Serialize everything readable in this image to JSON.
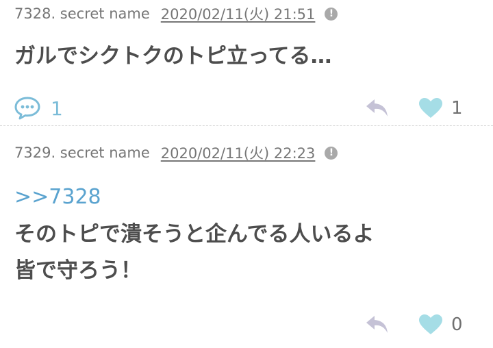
{
  "comments": [
    {
      "number_name": "7328. secret name",
      "datetime": "2020/02/11(火) 21:51",
      "body_lines": [
        "ガルでシクトクのトピ立ってる…"
      ],
      "reply_count": "1",
      "like_count": "1"
    },
    {
      "number_name": "7329. secret name",
      "datetime": "2020/02/11(火) 22:23",
      "anchor": ">>7328",
      "body_lines": [
        "そのトピで潰そうと企んでる人いるよ",
        "皆で守ろう！"
      ],
      "like_count": "0"
    }
  ],
  "icons": {
    "report": "exclamation-circle-icon",
    "comments": "speech-bubble-icon",
    "reply": "reply-arrow-icon",
    "like": "heart-icon"
  },
  "colors": {
    "anchor_link": "#5aa3cf",
    "comment_icon": "#7bbcd8",
    "like_heart": "#a5dde6",
    "reply_arrow": "#c5c2d6",
    "meta_text": "#767676",
    "body_text": "#4d4d4d"
  }
}
